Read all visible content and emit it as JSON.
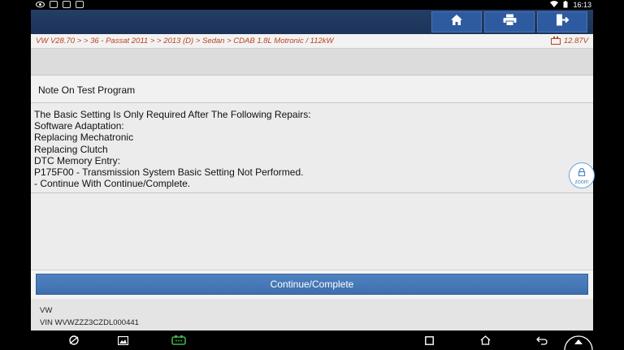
{
  "status_bar": {
    "time": "16:13",
    "left_icons": [
      "eye-icon",
      "image-icon",
      "car-icon",
      "exit-icon"
    ],
    "right_icons": [
      "wifi-icon",
      "battery-icon"
    ]
  },
  "toolbar": {
    "buttons": [
      {
        "icon": "home-icon"
      },
      {
        "icon": "print-icon"
      },
      {
        "icon": "exit-icon"
      }
    ]
  },
  "breadcrumb": {
    "path": "VW V28.70 > > 36 - Passat 2011 > > 2013 (D) > Sedan > CDAB 1.8L Motronic / 112kW",
    "voltage": "12.87V"
  },
  "dialog": {
    "title": "Note On Test Program",
    "lines": [
      " The Basic Setting Is Only Required After The Following Repairs:",
      " Software Adaptation:",
      " Replacing Mechatronic",
      " Replacing Clutch",
      " DTC Memory Entry:",
      "P175F00 - Transmission System Basic Setting Not Performed.",
      "- Continue With Continue/Complete."
    ]
  },
  "zoom": {
    "label": "zoom"
  },
  "actions": {
    "continue_label": "Continue/Complete"
  },
  "vehicle": {
    "make": "VW",
    "vin": "VIN WVWZZZ3CZDL000441"
  },
  "colors": {
    "toolbar": "#1d3358",
    "button": "#4a7ab8",
    "breadcrumb_text": "#b8421f",
    "connector_icon": "#3bb34a"
  }
}
